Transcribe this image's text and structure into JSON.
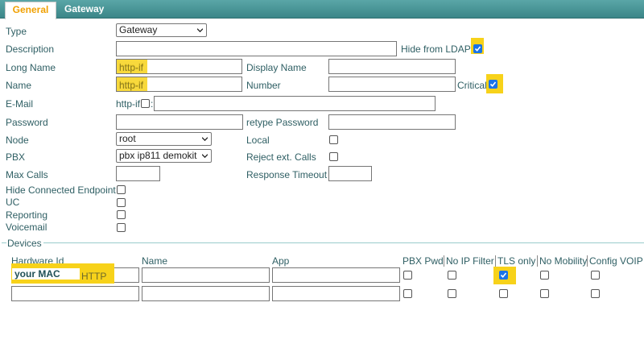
{
  "tabs": [
    {
      "label": "General",
      "active": true
    },
    {
      "label": "Gateway",
      "active": false
    }
  ],
  "form": {
    "type_label": "Type",
    "type_value": "Gateway",
    "description_label": "Description",
    "description_value": "",
    "hide_ldap_label": "Hide from LDAP",
    "hide_ldap_checked": true,
    "long_name_label": "Long Name",
    "long_name_value": "http-if",
    "display_name_label": "Display Name",
    "display_name_value": "",
    "name_label": "Name",
    "name_value": "http-if",
    "number_label": "Number",
    "number_value": "",
    "critical_label": "Critical",
    "critical_checked": true,
    "email_label": "E-Mail",
    "email_prefix": "http-if",
    "email_value": "",
    "password_label": "Password",
    "retype_password_label": "retype Password",
    "node_label": "Node",
    "node_value": "root",
    "local_label": "Local",
    "pbx_label": "PBX",
    "pbx_value": "pbx ip811 demokit",
    "reject_ext_calls_label": "Reject ext. Calls",
    "max_calls_label": "Max Calls",
    "max_calls_value": "",
    "response_timeout_label": "Response Timeout",
    "response_timeout_value": "",
    "hide_connected_endpoint_label": "Hide Connected Endpoint",
    "uc_label": "UC",
    "reporting_label": "Reporting",
    "voicemail_label": "Voicemail"
  },
  "devices": {
    "section_label": "Devices",
    "columns": [
      "Hardware Id",
      "Name",
      "App",
      "PBX Pwd",
      "No IP Filter",
      "TLS only",
      "No Mobility",
      "Config VOIP"
    ],
    "rows": [
      {
        "hardware_id": "your MAC",
        "hardware_suffix": "HTTP",
        "name": "",
        "app": "",
        "pbx_pwd": false,
        "no_ip_filter": false,
        "tls_only": true,
        "no_mobility": false,
        "config_voip": false
      },
      {
        "hardware_id": "",
        "hardware_suffix": "",
        "name": "",
        "app": "",
        "pbx_pwd": false,
        "no_ip_filter": false,
        "tls_only": false,
        "no_mobility": false,
        "config_voip": false
      }
    ]
  },
  "colors": {
    "tab_bar": "#4a9898",
    "active_tab_text": "#f0a000",
    "label_text": "#2f5f64",
    "highlight": "#f7d21a",
    "checkbox_checked": "#1a73e8"
  }
}
